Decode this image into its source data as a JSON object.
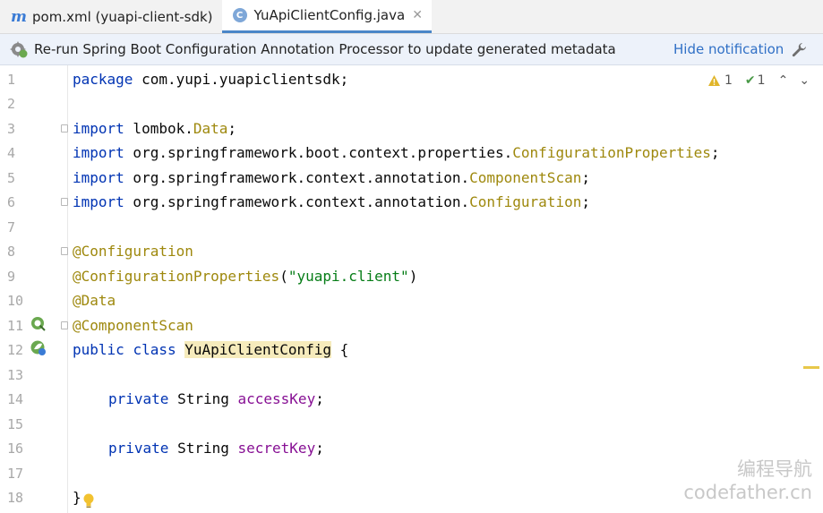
{
  "tabs": [
    {
      "label": "pom.xml (yuapi-client-sdk)",
      "icon": "maven-m-icon",
      "active": false
    },
    {
      "label": "YuApiClientConfig.java",
      "icon": "class-c-icon",
      "active": true
    }
  ],
  "notification": {
    "message": "Re-run Spring Boot Configuration Annotation Processor to update generated metadata",
    "action": "Hide notification"
  },
  "inspection": {
    "warnings": "1",
    "weak_warnings": "1"
  },
  "line_numbers": [
    "1",
    "2",
    "3",
    "4",
    "5",
    "6",
    "7",
    "8",
    "9",
    "10",
    "11",
    "12",
    "13",
    "14",
    "15",
    "16",
    "17",
    "18"
  ],
  "code": {
    "l1": {
      "kw": "package",
      "rest": " com.yupi.yuapiclientsdk;"
    },
    "l3": {
      "kw": "import",
      "pkg": " lombok.",
      "ty": "Data",
      "end": ";"
    },
    "l4": {
      "kw": "import",
      "pkg": " org.springframework.boot.context.properties.",
      "ty": "ConfigurationProperties",
      "end": ";"
    },
    "l5": {
      "kw": "import",
      "pkg": " org.springframework.context.annotation.",
      "ty": "ComponentScan",
      "end": ";"
    },
    "l6": {
      "kw": "import",
      "pkg": " org.springframework.context.annotation.",
      "ty": "Configuration",
      "end": ";"
    },
    "l8": {
      "an": "@Configuration"
    },
    "l9": {
      "an": "@ConfigurationProperties",
      "open": "(",
      "str": "\"yuapi.client\"",
      "close": ")"
    },
    "l10": {
      "an": "@Data"
    },
    "l11": {
      "an": "@ComponentScan"
    },
    "l12": {
      "kw1": "public",
      "kw2": "class",
      "name": "YuApiClientConfig",
      "brace": " {"
    },
    "l14": {
      "kw": "private",
      "type": " String ",
      "field": "accessKey",
      "end": ";"
    },
    "l16": {
      "kw": "private",
      "type": " String ",
      "field": "secretKey",
      "end": ";"
    },
    "l18": {
      "brace": "}"
    }
  },
  "watermark": {
    "line1": "编程导航",
    "line2": "codefather.cn"
  },
  "colors": {
    "keyword": "#0033b3",
    "annotation": "#9e880d",
    "string": "#067d17",
    "field": "#871094"
  }
}
